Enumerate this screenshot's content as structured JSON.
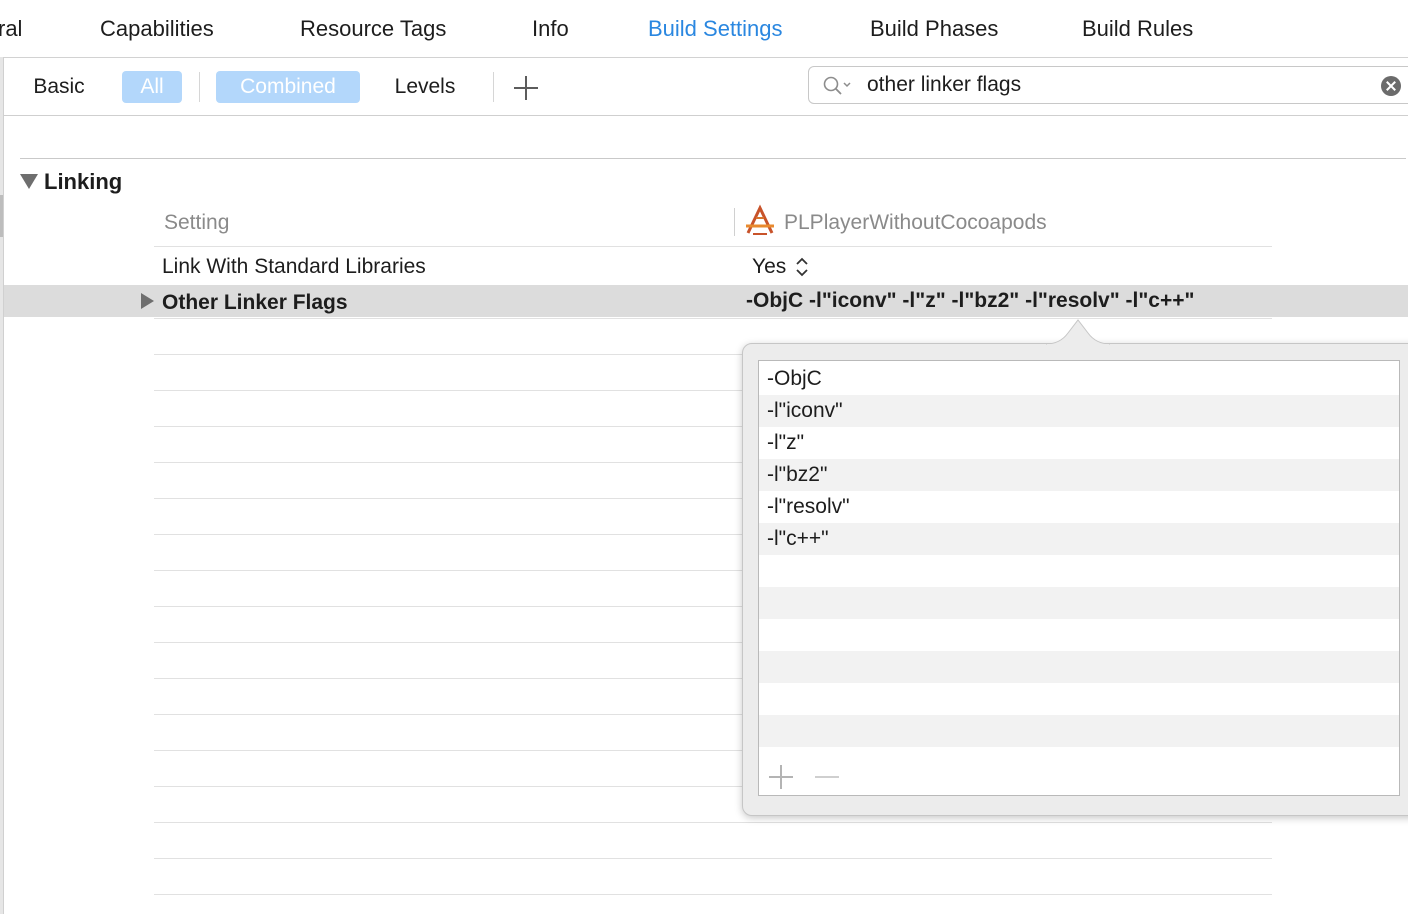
{
  "tabs": [
    {
      "label": "ral",
      "active": false
    },
    {
      "label": "Capabilities",
      "active": false
    },
    {
      "label": "Resource Tags",
      "active": false
    },
    {
      "label": "Info",
      "active": false
    },
    {
      "label": "Build Settings",
      "active": true
    },
    {
      "label": "Build Phases",
      "active": false
    },
    {
      "label": "Build Rules",
      "active": false
    }
  ],
  "filter": {
    "basic": "Basic",
    "all": "All",
    "combined": "Combined",
    "levels": "Levels",
    "selected": [
      "All",
      "Combined"
    ]
  },
  "search": {
    "value": "other linker flags",
    "placeholder": ""
  },
  "section": {
    "title": "Linking",
    "expanded": true
  },
  "columns": {
    "setting": "Setting",
    "target": "PLPlayerWithoutCocoapods"
  },
  "rows": [
    {
      "name": "Link With Standard Libraries",
      "value": "Yes"
    },
    {
      "name": "Other Linker Flags",
      "value": "-ObjC -l\"iconv\" -l\"z\" -l\"bz2\" -l\"resolv\" -l\"c++\""
    }
  ],
  "popover": {
    "items": [
      "-ObjC",
      "-l\"iconv\"",
      "-l\"z\"",
      "-l\"bz2\"",
      "-l\"resolv\"",
      "-l\"c++\""
    ]
  },
  "colors": {
    "accent": "#2a87e0",
    "selected_segment": "#b3d7fb",
    "selected_row": "#dcdcdc"
  },
  "icons": [
    "search-icon",
    "clear-search-icon",
    "add-icon",
    "disclosure-triangle-icon",
    "xcode-target-icon",
    "stepper-icon",
    "remove-icon"
  ]
}
